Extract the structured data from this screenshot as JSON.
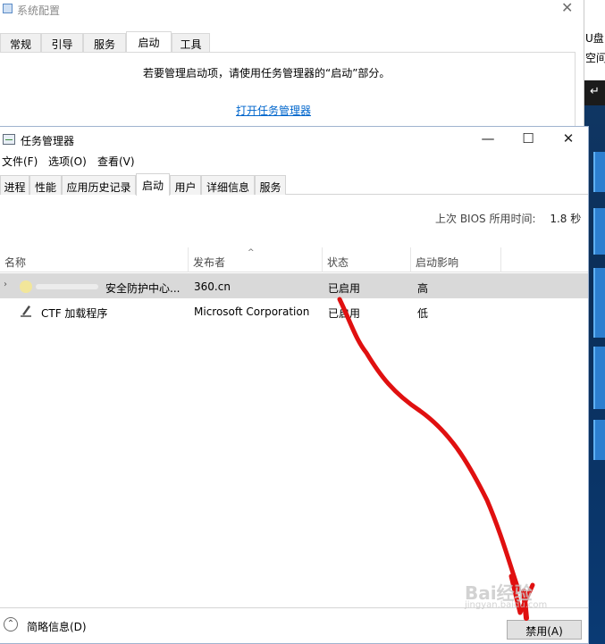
{
  "desktop": {
    "line1": "U盘 (",
    "line2": "空间:"
  },
  "sysconfig": {
    "title": "系统配置",
    "tabs": [
      "常规",
      "引导",
      "服务",
      "启动",
      "工具"
    ],
    "active_tab": "启动",
    "info_text": "若要管理启动项，请使用任务管理器的“启动”部分。",
    "link_text": "打开任务管理器"
  },
  "taskmgr": {
    "title": "任务管理器",
    "menus": [
      "文件(F)",
      "选项(O)",
      "查看(V)"
    ],
    "tabs": [
      "进程",
      "性能",
      "应用历史记录",
      "启动",
      "用户",
      "详细信息",
      "服务"
    ],
    "active_tab": "启动",
    "bios_label": "上次 BIOS 所用时间:",
    "bios_value": "1.8 秒",
    "columns": [
      "名称",
      "发布者",
      "状态",
      "启动影响"
    ],
    "rows": [
      {
        "name": "安全防护中心...",
        "publisher": "360.cn",
        "status": "已启用",
        "impact": "高"
      },
      {
        "name": "CTF 加载程序",
        "publisher": "Microsoft Corporation",
        "status": "已启用",
        "impact": "低"
      }
    ],
    "footer_label": "简略信息(D)",
    "disable_button": "禁用(A)"
  },
  "watermark": {
    "text": "Bai经验",
    "sub": "jingyan.baidu.com"
  }
}
